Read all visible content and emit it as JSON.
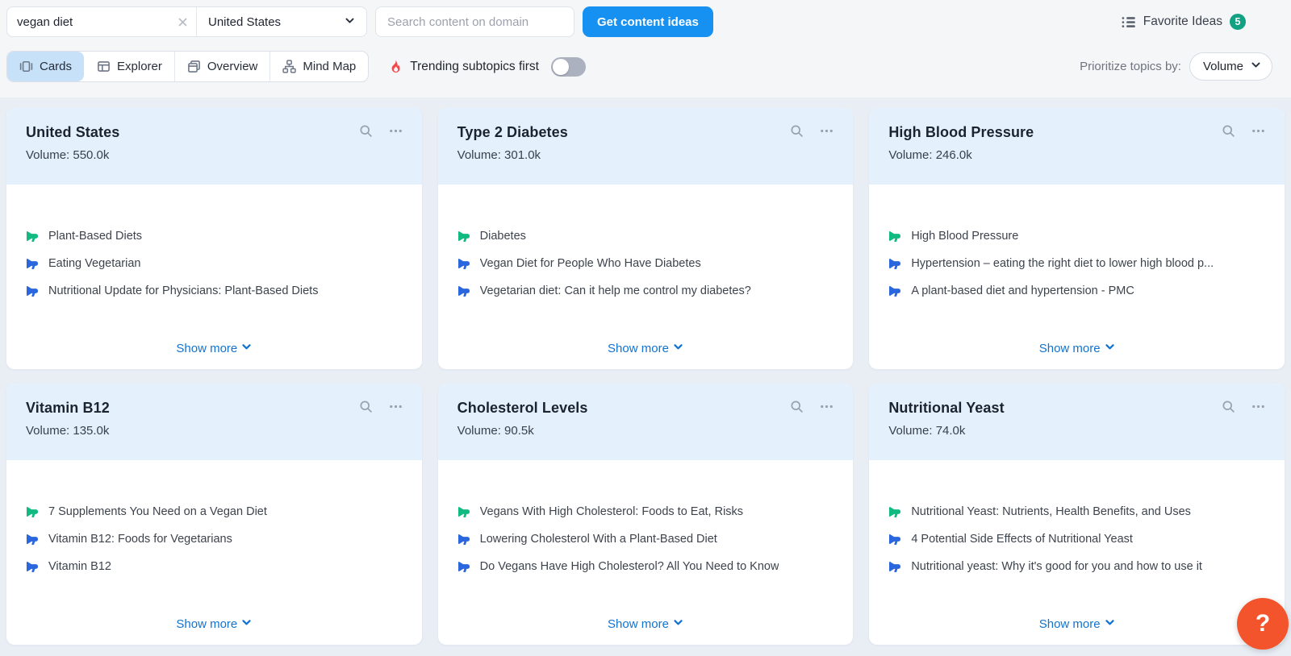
{
  "toolbar": {
    "search": {
      "value": "vegan diet",
      "clear_icon": "x-clear-icon"
    },
    "country": {
      "value": "United States"
    },
    "domain_search": {
      "placeholder": "Search content on domain"
    },
    "cta_label": "Get content ideas",
    "favorites": {
      "icon": "list-icon",
      "label": "Favorite Ideas",
      "count": "5"
    }
  },
  "view_bar": {
    "tabs": [
      {
        "label": "Cards",
        "icon": "cards-icon",
        "active": true
      },
      {
        "label": "Explorer",
        "icon": "table-icon",
        "active": false
      },
      {
        "label": "Overview",
        "icon": "windows-icon",
        "active": false
      },
      {
        "label": "Mind Map",
        "icon": "mindmap-icon",
        "active": false
      }
    ],
    "trending_label": "Trending subtopics first",
    "trending_toggle_state": "off",
    "prioritize_label": "Prioritize topics by:",
    "prioritize_value": "Volume"
  },
  "cards_shared": {
    "show_more": "Show more"
  },
  "cards": [
    {
      "title": "United States",
      "volume_text": "Volume: 550.0k",
      "headlines": [
        "Plant-Based Diets",
        "Eating Vegetarian",
        "Nutritional Update for Physicians: Plant-Based Diets"
      ]
    },
    {
      "title": "Type 2 Diabetes",
      "volume_text": "Volume: 301.0k",
      "headlines": [
        "Diabetes",
        "Vegan Diet for People Who Have Diabetes",
        "Vegetarian diet: Can it help me control my diabetes?"
      ]
    },
    {
      "title": "High Blood Pressure",
      "volume_text": "Volume: 246.0k",
      "headlines": [
        "High Blood Pressure",
        "Hypertension – eating the right diet to lower high blood p...",
        "A plant-based diet and hypertension - PMC"
      ]
    },
    {
      "title": "Vitamin B12",
      "volume_text": "Volume: 135.0k",
      "headlines": [
        "7 Supplements You Need on a Vegan Diet",
        "Vitamin B12: Foods for Vegetarians",
        "Vitamin B12"
      ]
    },
    {
      "title": "Cholesterol Levels",
      "volume_text": "Volume: 90.5k",
      "headlines": [
        "Vegans With High Cholesterol: Foods to Eat, Risks",
        "Lowering Cholesterol With a Plant-Based Diet",
        "Do Vegans Have High Cholesterol? All You Need to Know"
      ]
    },
    {
      "title": "Nutritional Yeast",
      "volume_text": "Volume: 74.0k",
      "headlines": [
        "Nutritional Yeast: Nutrients, Health Benefits, and Uses",
        "4 Potential Side Effects of Nutritional Yeast",
        "Nutritional yeast: Why it's good for you and how to use it"
      ]
    }
  ],
  "help": {
    "label": "?"
  },
  "colors": {
    "page_bg": "#F5F6F8",
    "cards_area_bg": "#E9EEF5",
    "card_header_bg": "#E4F1FC",
    "accent_blue": "#1691F2",
    "link_blue": "#1273D0",
    "tab_active_bg": "#C7E1F8",
    "megaphone_green": "#10BA81",
    "megaphone_blue": "#2A66DD",
    "fire_red": "#F2484E",
    "badge_green": "#12A182",
    "help_orange": "#F4542C",
    "toggle_off": "#ABB1BE"
  }
}
